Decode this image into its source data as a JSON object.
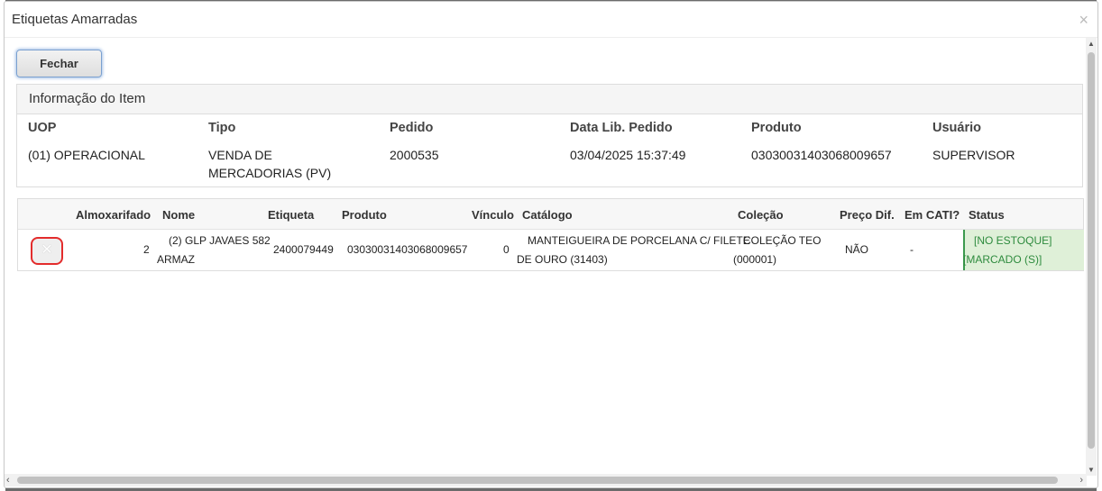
{
  "dialog": {
    "title": "Etiquetas Amarradas",
    "close_glyph": "×",
    "close_button_label": "Fechar"
  },
  "info": {
    "heading": "Informação do Item",
    "columns": [
      {
        "label": "UOP",
        "value_line1": "(01) OPERACIONAL",
        "value_line2": ""
      },
      {
        "label": "Tipo",
        "value_line1": "VENDA DE",
        "value_line2": "MERCADORIAS (PV)"
      },
      {
        "label": "Pedido",
        "value_line1": "2000535",
        "value_line2": ""
      },
      {
        "label": "Data Lib. Pedido",
        "value_line1": "03/04/2025 15:37:49",
        "value_line2": ""
      },
      {
        "label": "Produto",
        "value_line1": "03030031403068009657",
        "value_line2": ""
      },
      {
        "label": "Usuário",
        "value_line1": "SUPERVISOR",
        "value_line2": ""
      }
    ]
  },
  "table": {
    "headers": {
      "almoxarifado": "Almoxarifado",
      "nome": "Nome",
      "etiqueta": "Etiqueta",
      "produto": "Produto",
      "vinculo": "Vínculo",
      "catalogo": "Catálogo",
      "colecao": "Coleção",
      "preco_dif": "Preço Dif.",
      "em_cati": "Em CATI?",
      "status": "Status"
    },
    "rows": [
      {
        "remove_glyph": "✕",
        "almoxarifado": "2",
        "nome_line1": "(2) GLP JAVAES 582",
        "nome_line2": "ARMAZ",
        "etiqueta": "2400079449",
        "produto": "03030031403068009657",
        "vinculo": "0",
        "catalogo_line1": "MANTEIGUEIRA DE PORCELANA C/ FILETE",
        "catalogo_line2": "DE OURO (31403)",
        "colecao_line1": "COLEÇÃO TEO",
        "colecao_line2": "(000001)",
        "preco_dif": "NÃO",
        "em_cati": "-",
        "status_line1": "[NO ESTOQUE]",
        "status_line2": "[MARCADO (S)]"
      }
    ]
  },
  "colors": {
    "status_bg": "#dff0d8",
    "status_text": "#2e8b3e",
    "remove_border": "#e32c2c"
  }
}
